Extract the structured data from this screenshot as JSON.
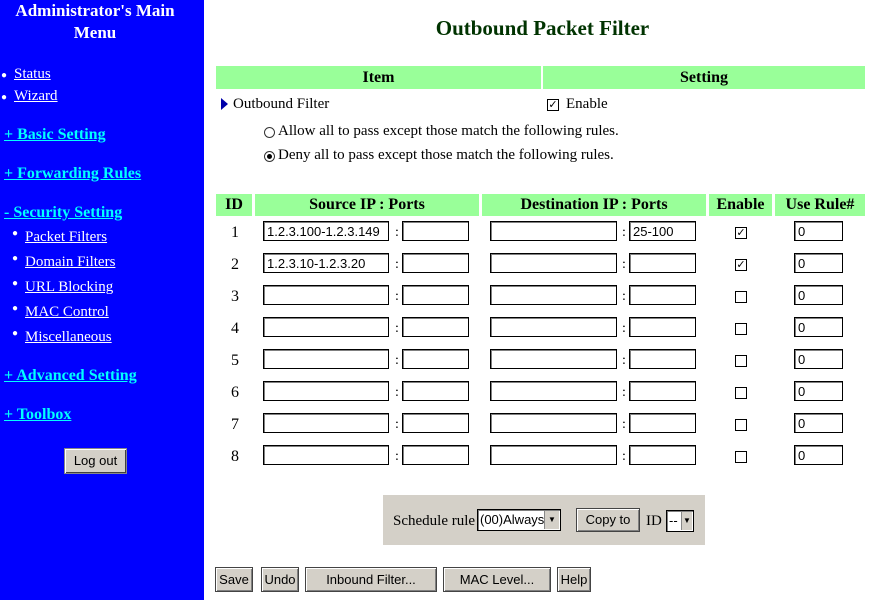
{
  "sidebar": {
    "title_line1": "Administrator's Main",
    "title_line2": "Menu",
    "links": [
      "Status",
      "Wizard"
    ],
    "sections": {
      "basic": "+ Basic Setting",
      "forwarding": "+ Forwarding Rules",
      "security": "- Security Setting",
      "advanced": "+ Advanced Setting",
      "toolbox": "+ Toolbox"
    },
    "security_items": [
      "Packet Filters",
      "Domain Filters",
      "URL Blocking",
      "MAC Control",
      "Miscellaneous"
    ],
    "logout": "Log out"
  },
  "page": {
    "title": "Outbound Packet Filter",
    "item_header": "Item",
    "setting_header": "Setting",
    "filter_label": "Outbound Filter",
    "enable_label": "Enable",
    "enabled": true,
    "radio_allow": "Allow all to pass except those match the following rules.",
    "radio_deny": "Deny all to pass except those match the following rules.",
    "selected_rule": "deny"
  },
  "table": {
    "headers": [
      "ID",
      "Source IP : Ports",
      "Destination IP : Ports",
      "Enable",
      "Use Rule#"
    ],
    "rows": [
      {
        "id": "1",
        "src_ip": "1.2.3.100-1.2.3.149",
        "src_port": "",
        "dst_ip": "",
        "dst_port": "25-100",
        "enabled": true,
        "rule": "0"
      },
      {
        "id": "2",
        "src_ip": "1.2.3.10-1.2.3.20",
        "src_port": "",
        "dst_ip": "",
        "dst_port": "",
        "enabled": true,
        "rule": "0"
      },
      {
        "id": "3",
        "src_ip": "",
        "src_port": "",
        "dst_ip": "",
        "dst_port": "",
        "enabled": false,
        "rule": "0"
      },
      {
        "id": "4",
        "src_ip": "",
        "src_port": "",
        "dst_ip": "",
        "dst_port": "",
        "enabled": false,
        "rule": "0"
      },
      {
        "id": "5",
        "src_ip": "",
        "src_port": "",
        "dst_ip": "",
        "dst_port": "",
        "enabled": false,
        "rule": "0"
      },
      {
        "id": "6",
        "src_ip": "",
        "src_port": "",
        "dst_ip": "",
        "dst_port": "",
        "enabled": false,
        "rule": "0"
      },
      {
        "id": "7",
        "src_ip": "",
        "src_port": "",
        "dst_ip": "",
        "dst_port": "",
        "enabled": false,
        "rule": "0"
      },
      {
        "id": "8",
        "src_ip": "",
        "src_port": "",
        "dst_ip": "",
        "dst_port": "",
        "enabled": false,
        "rule": "0"
      }
    ]
  },
  "schedule": {
    "label": "Schedule rule",
    "selected": "(00)Always",
    "copy_button": "Copy to",
    "id_label": "ID",
    "id_selected": "--"
  },
  "buttons": [
    "Save",
    "Undo",
    "Inbound Filter...",
    "MAC Level...",
    "Help"
  ],
  "colors": {
    "sidebar_bg": "#0000ff",
    "section_link": "#00ffff",
    "header_bg": "#99ff99",
    "title_color": "#003300"
  }
}
